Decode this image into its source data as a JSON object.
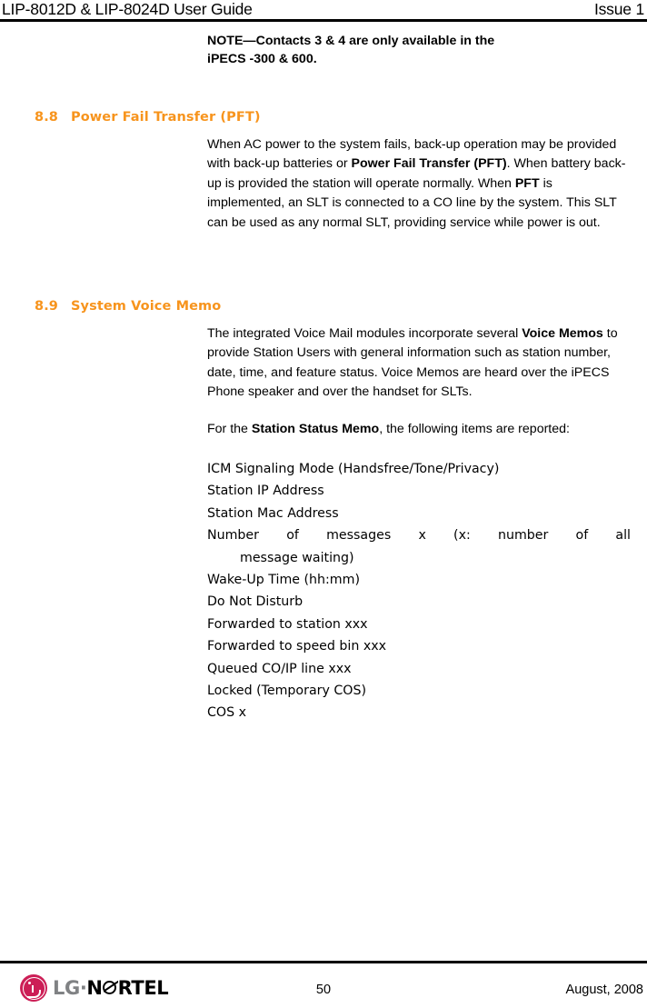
{
  "header": {
    "title": "LIP-8012D & LIP-8024D User Guide",
    "issue": "Issue 1"
  },
  "note": {
    "line1": "NOTE—Contacts 3 & 4 are only available in the",
    "line2": "iPECS -300 & 600."
  },
  "sections": [
    {
      "number": "8.8",
      "title": "Power Fail Transfer (PFT)",
      "paragraph": {
        "run1": "When AC power to the system fails, back-up operation may be provided with back-up batteries or ",
        "bold1": "Power Fail Transfer (PFT)",
        "run2": ".  When battery back-up is provided the station will operate normally.  When ",
        "bold2": "PFT",
        "run3": " is implemented, an SLT is connected to a CO line by the system.  This SLT can be used as any normal SLT, providing service while power is out."
      }
    },
    {
      "number": "8.9",
      "title": "System Voice Memo",
      "paragraph": {
        "run1": "The integrated Voice Mail modules incorporate several ",
        "bold1": "Voice Memos",
        "run2": " to provide Station Users with general information such as station number, date, time, and feature status.  Voice Memos are heard over the iPECS Phone speaker and over the handset for SLTs."
      },
      "subparagraph": {
        "run1": "For the ",
        "bold1": "Station Status Memo",
        "run2": ", the following items are reported:"
      },
      "items": [
        "ICM Signaling Mode (Handsfree/Tone/Privacy)",
        "Station IP Address",
        "Station Mac Address",
        "Number of messages x (x: number of all",
        "message waiting)",
        "Wake-Up Time (hh:mm)",
        "Do Not Disturb",
        "Forwarded to station xxx",
        "Forwarded to speed bin xxx",
        "Queued CO/IP line xxx",
        "Locked (Temporary COS)",
        "COS x"
      ]
    }
  ],
  "footer": {
    "logo_lg": "LG",
    "logo_dot": "·",
    "logo_n": "N",
    "logo_rtel": "RTEL",
    "page_number": "50",
    "date": "August, 2008"
  },
  "colors": {
    "heading_orange": "#F7941D",
    "logo_magenta": "#CC1E56",
    "logo_gray": "#808284"
  }
}
